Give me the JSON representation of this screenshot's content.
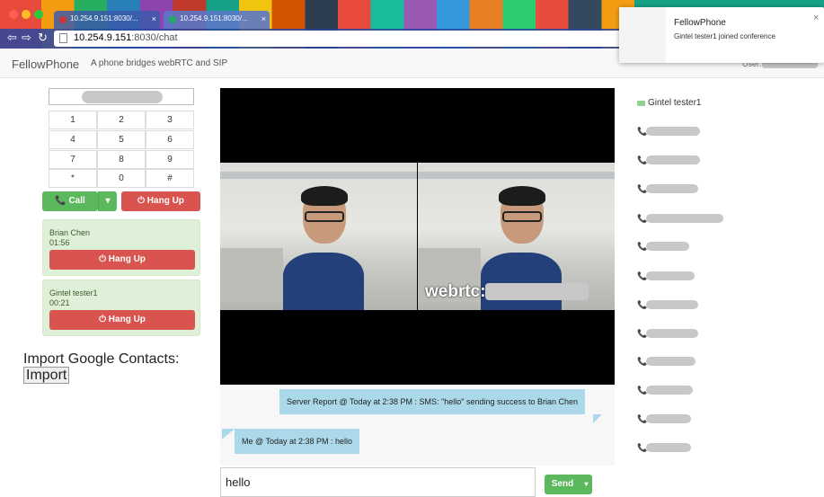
{
  "browser": {
    "tabs": [
      {
        "title": "10.254.9.151:8030/..."
      },
      {
        "title": "10.254.9.151:8030/..."
      }
    ],
    "url_host": "10.254.9.151",
    "url_path": ":8030/chat"
  },
  "navbar": {
    "brand": "FellowPhone",
    "tagline": "A phone bridges webRTC and SIP",
    "user_label": "User:"
  },
  "dialpad": {
    "keys": [
      "1",
      "2",
      "3",
      "4",
      "5",
      "6",
      "7",
      "8",
      "9",
      "*",
      "0",
      "#"
    ],
    "call_label": "Call",
    "caret": "▾",
    "hangup_label": "Hang Up"
  },
  "active_calls": [
    {
      "name": "Brian Chen",
      "duration": "01:56",
      "hangup_label": "Hang Up"
    },
    {
      "name": "Gintel tester1",
      "duration": "00:21",
      "hangup_label": "Hang Up"
    }
  ],
  "import": {
    "title": "Import Google Contacts:",
    "link": "Import"
  },
  "video": {
    "overlay_label": "webrtc:"
  },
  "chat": {
    "messages": [
      {
        "text": "Server Report @ Today at 2:38 PM : SMS: \"hello\" sending success to Brian Chen",
        "side": "right"
      },
      {
        "text": "Me @ Today at 2:38 PM : hello",
        "side": "left"
      }
    ],
    "input_value": "hello",
    "send_label": "Send",
    "send_caret": "▾"
  },
  "contacts": {
    "online": "Gintel tester1",
    "online_color": "#8fd18f"
  },
  "notification": {
    "title": "FellowPhone",
    "body": "Gintel tester1 joined conference",
    "close": "×"
  },
  "colors": {
    "success": "#5cb85c",
    "danger": "#d9534f",
    "callcard_bg": "#dff0d8",
    "chat_bubble": "#abd9e9"
  },
  "icons": {
    "phone": "phone-icon",
    "power": "power-icon"
  }
}
